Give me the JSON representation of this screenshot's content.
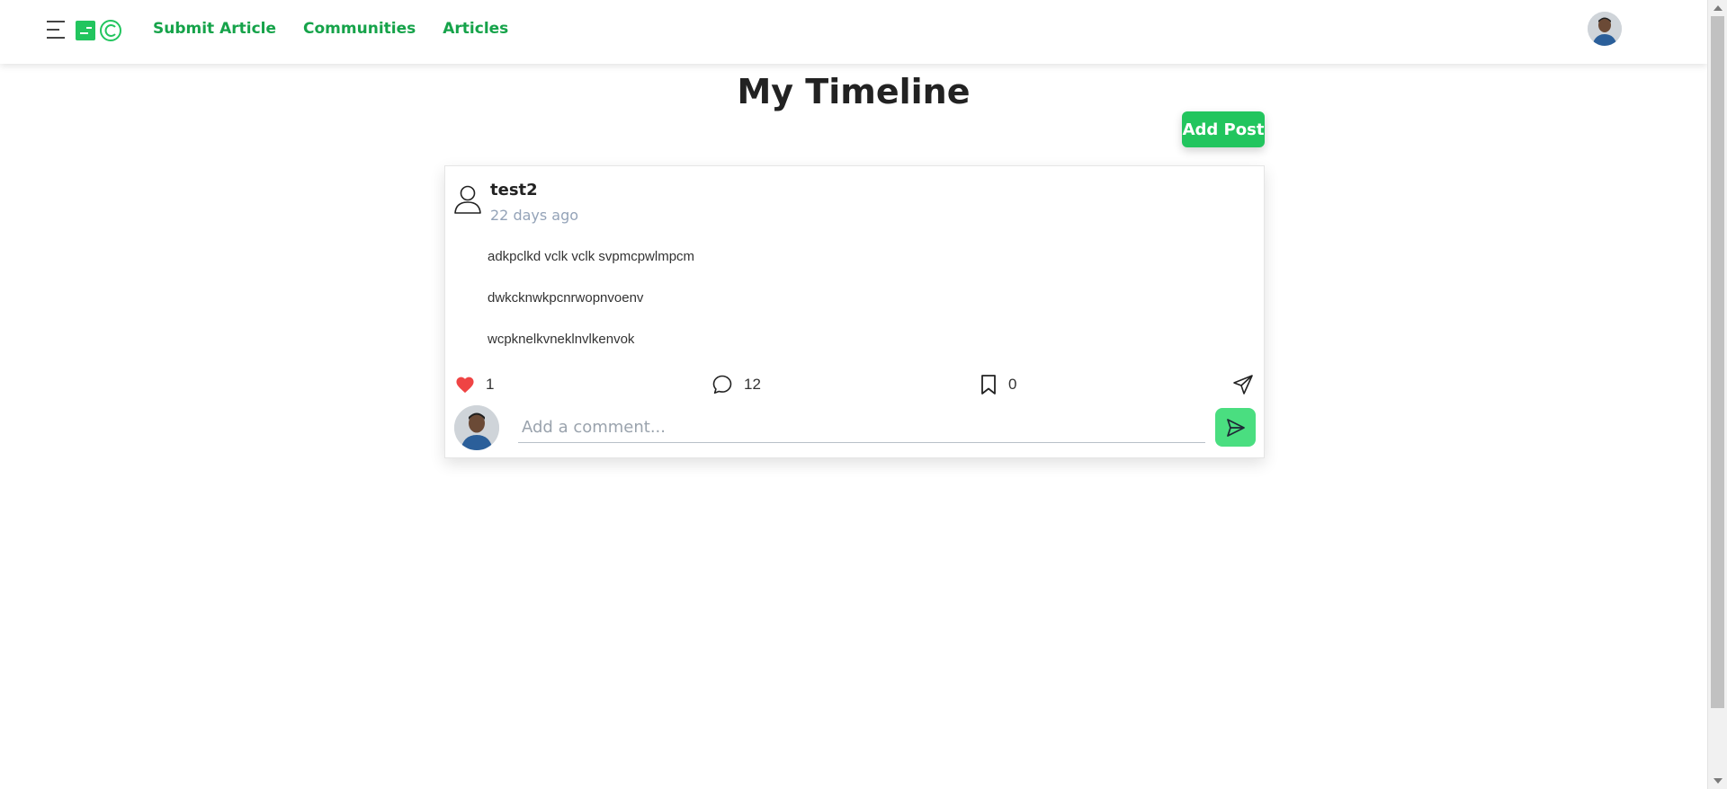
{
  "header": {
    "nav": [
      {
        "label": "Submit Article"
      },
      {
        "label": "Communities"
      },
      {
        "label": "Articles"
      }
    ],
    "brand_color": "#22c55e"
  },
  "page": {
    "title": "My Timeline",
    "add_post_label": "Add Post"
  },
  "post": {
    "author": "test2",
    "time": "22 days ago",
    "lines": [
      "adkpclkd vclk vclk svpmcpwlmpcm",
      "dwkcknwkpcnrwopnvoenv",
      "wcpknelkvneklnvlkenvok"
    ],
    "likes": "1",
    "comments": "12",
    "bookmarks": "0",
    "comment_placeholder": "Add a comment..."
  },
  "colors": {
    "accent": "#22c55e",
    "link": "#16a34a",
    "like": "#ef4444",
    "muted": "#94a3b8"
  }
}
